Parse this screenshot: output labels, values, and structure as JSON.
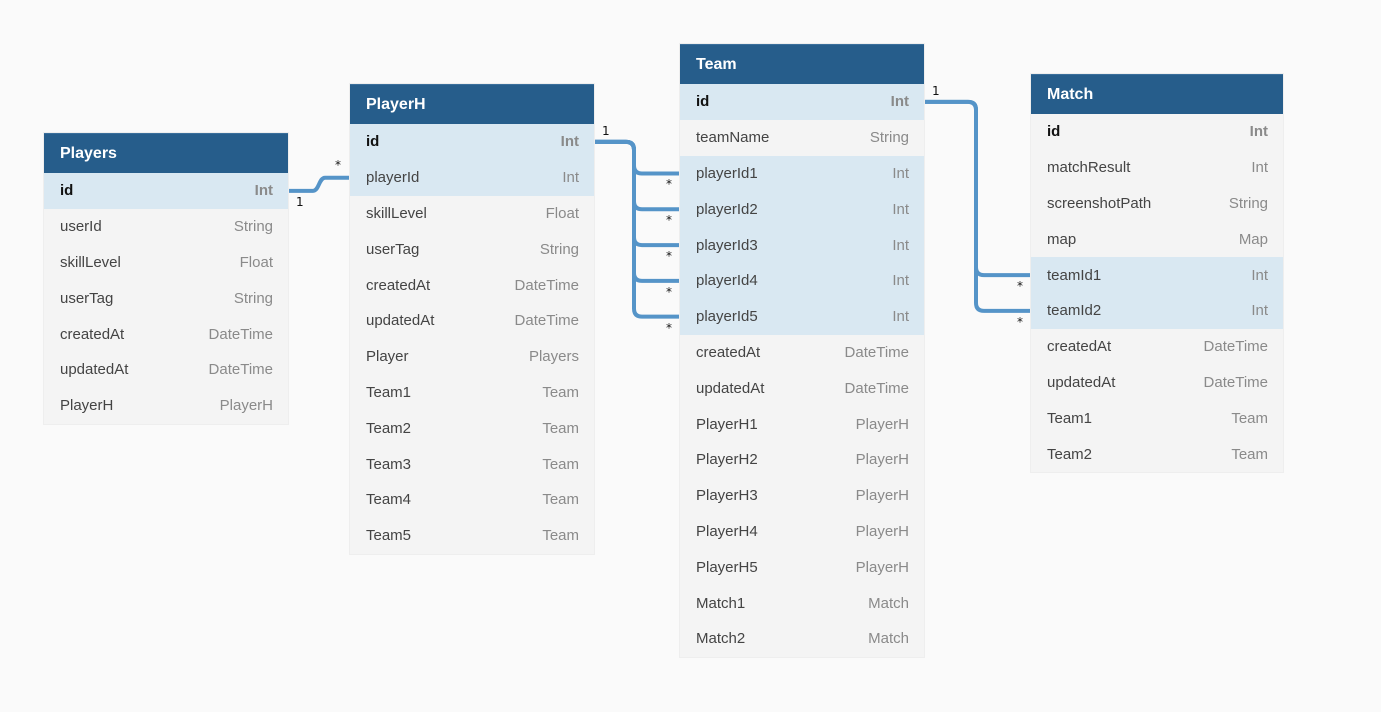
{
  "tables": {
    "players": {
      "name": "Players",
      "fields": [
        {
          "name": "id",
          "type": "Int",
          "pk": true,
          "highlight": true
        },
        {
          "name": "userId",
          "type": "String"
        },
        {
          "name": "skillLevel",
          "type": "Float"
        },
        {
          "name": "userTag",
          "type": "String"
        },
        {
          "name": "createdAt",
          "type": "DateTime"
        },
        {
          "name": "updatedAt",
          "type": "DateTime"
        },
        {
          "name": "PlayerH",
          "type": "PlayerH"
        }
      ]
    },
    "playerh": {
      "name": "PlayerH",
      "fields": [
        {
          "name": "id",
          "type": "Int",
          "pk": true,
          "highlight": true
        },
        {
          "name": "playerId",
          "type": "Int",
          "highlight": true
        },
        {
          "name": "skillLevel",
          "type": "Float"
        },
        {
          "name": "userTag",
          "type": "String"
        },
        {
          "name": "createdAt",
          "type": "DateTime"
        },
        {
          "name": "updatedAt",
          "type": "DateTime"
        },
        {
          "name": "Player",
          "type": "Players"
        },
        {
          "name": "Team1",
          "type": "Team"
        },
        {
          "name": "Team2",
          "type": "Team"
        },
        {
          "name": "Team3",
          "type": "Team"
        },
        {
          "name": "Team4",
          "type": "Team"
        },
        {
          "name": "Team5",
          "type": "Team"
        }
      ]
    },
    "team": {
      "name": "Team",
      "fields": [
        {
          "name": "id",
          "type": "Int",
          "pk": true,
          "highlight": true
        },
        {
          "name": "teamName",
          "type": "String"
        },
        {
          "name": "playerId1",
          "type": "Int",
          "highlight": true
        },
        {
          "name": "playerId2",
          "type": "Int",
          "highlight": true
        },
        {
          "name": "playerId3",
          "type": "Int",
          "highlight": true
        },
        {
          "name": "playerId4",
          "type": "Int",
          "highlight": true
        },
        {
          "name": "playerId5",
          "type": "Int",
          "highlight": true
        },
        {
          "name": "createdAt",
          "type": "DateTime"
        },
        {
          "name": "updatedAt",
          "type": "DateTime"
        },
        {
          "name": "PlayerH1",
          "type": "PlayerH"
        },
        {
          "name": "PlayerH2",
          "type": "PlayerH"
        },
        {
          "name": "PlayerH3",
          "type": "PlayerH"
        },
        {
          "name": "PlayerH4",
          "type": "PlayerH"
        },
        {
          "name": "PlayerH5",
          "type": "PlayerH"
        },
        {
          "name": "Match1",
          "type": "Match"
        },
        {
          "name": "Match2",
          "type": "Match"
        }
      ]
    },
    "match": {
      "name": "Match",
      "fields": [
        {
          "name": "id",
          "type": "Int",
          "pk": true
        },
        {
          "name": "matchResult",
          "type": "Int"
        },
        {
          "name": "screenshotPath",
          "type": "String"
        },
        {
          "name": "map",
          "type": "Map"
        },
        {
          "name": "teamId1",
          "type": "Int",
          "highlight": true
        },
        {
          "name": "teamId2",
          "type": "Int",
          "highlight": true
        },
        {
          "name": "createdAt",
          "type": "DateTime"
        },
        {
          "name": "updatedAt",
          "type": "DateTime"
        },
        {
          "name": "Team1",
          "type": "Team"
        },
        {
          "name": "Team2",
          "type": "Team"
        }
      ]
    }
  },
  "relations": [
    {
      "from": "Players.id",
      "to": "PlayerH.playerId",
      "from_card": "1",
      "to_card": "*"
    },
    {
      "from": "PlayerH.id",
      "to": "Team.playerId1",
      "from_card": "1",
      "to_card": "*"
    },
    {
      "from": "PlayerH.id",
      "to": "Team.playerId2",
      "from_card": "1",
      "to_card": "*"
    },
    {
      "from": "PlayerH.id",
      "to": "Team.playerId3",
      "from_card": "1",
      "to_card": "*"
    },
    {
      "from": "PlayerH.id",
      "to": "Team.playerId4",
      "from_card": "1",
      "to_card": "*"
    },
    {
      "from": "PlayerH.id",
      "to": "Team.playerId5",
      "from_card": "1",
      "to_card": "*"
    },
    {
      "from": "Team.id",
      "to": "Match.teamId1",
      "from_card": "1",
      "to_card": "*"
    },
    {
      "from": "Team.id",
      "to": "Match.teamId2",
      "from_card": "1",
      "to_card": "*"
    }
  ],
  "colors": {
    "header": "#265d8b",
    "row_bg": "#f4f4f4",
    "row_highlight": "#d9e8f2",
    "edge": "#5594c8",
    "canvas": "#fafafa"
  }
}
